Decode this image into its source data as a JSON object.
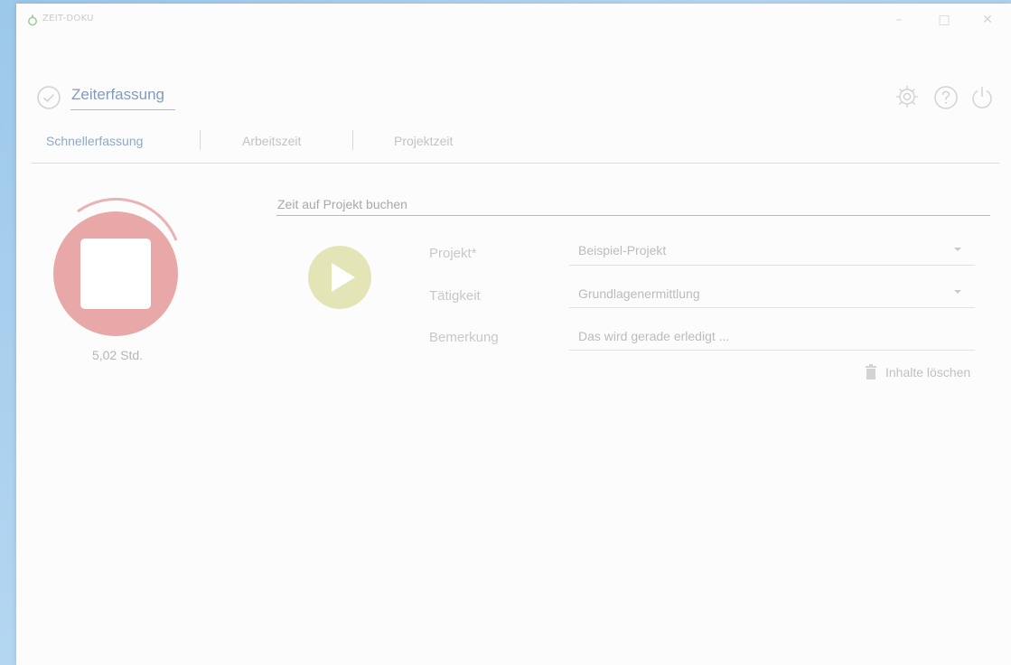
{
  "window": {
    "app_title": "ZEIT-DOKU",
    "controls": {
      "minimize": "–",
      "maximize": "□",
      "close": "✕"
    }
  },
  "header": {
    "title": "Zeiterfassung",
    "icons": [
      "clock-check-icon",
      "gear-icon",
      "help-icon",
      "power-icon"
    ]
  },
  "tabs": [
    {
      "label": "Schnellerfassung",
      "active": true
    },
    {
      "label": "Arbeitszeit",
      "active": false
    },
    {
      "label": "Projektzeit",
      "active": false
    }
  ],
  "timer": {
    "value": "5,02 Std.",
    "stop_color": "#e9a8a8",
    "ring_color": "#e7b3b3"
  },
  "booking": {
    "section_title": "Zeit auf Projekt buchen",
    "play_color": "#e3e5b7",
    "fields": [
      {
        "label": "Projekt*",
        "value": "Beispiel-Projekt",
        "type": "select"
      },
      {
        "label": "Tätigkeit",
        "value": "Grundlagenermittlung",
        "type": "select"
      },
      {
        "label": "Bemerkung",
        "value": "Das wird gerade erledigt ...",
        "type": "text"
      }
    ],
    "clear_label": "Inhalte löschen"
  },
  "colors": {
    "accent": "#7f9cc0",
    "background": "#fcfcfc"
  }
}
